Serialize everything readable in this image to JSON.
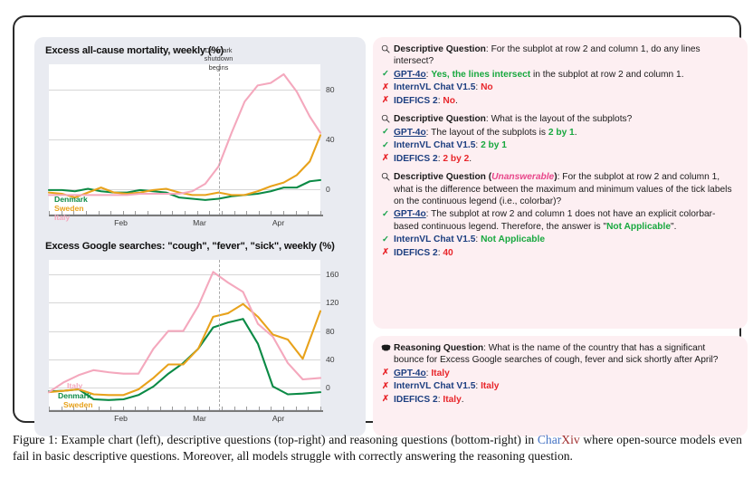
{
  "figure": {
    "caption_prefix": "Figure 1:",
    "caption_part1": " Example chart (left), descriptive questions (top-right) and reasoning questions (bottom-right) in ",
    "caption_brand_char": "Char",
    "caption_brand_xiv": "Xiv",
    "caption_part2": " where open-source models even fail in basic descriptive questions. Moreover, all models struggle with correctly answering the reasoning question."
  },
  "chart_data": [
    {
      "type": "line",
      "title": "Excess all-cause mortality, weekly (%)",
      "xlabel": "",
      "ylabel": "",
      "ylim": [
        -20,
        100
      ],
      "yticks": [
        0,
        40,
        80
      ],
      "xtick_labels": [
        "Feb",
        "Mar",
        "Apr"
      ],
      "xtick_positions": [
        0.265,
        0.555,
        0.845
      ],
      "grid": true,
      "legend_position": "inline-left",
      "annotation": {
        "text_lines": [
          "Denmark",
          "shutdown",
          "begins"
        ],
        "x_fraction": 0.625
      },
      "series": [
        {
          "name": "Denmark",
          "color": "#0b8a45",
          "x": [
            0.0,
            0.048,
            0.096,
            0.144,
            0.192,
            0.24,
            0.288,
            0.336,
            0.384,
            0.432,
            0.48,
            0.528,
            0.576,
            0.625,
            0.673,
            0.721,
            0.769,
            0.817,
            0.865,
            0.913,
            0.961,
            1.0
          ],
          "values": [
            -1,
            -1,
            -2,
            0,
            -2,
            -3,
            -3,
            -1,
            -2,
            -3,
            -7,
            -8,
            -9,
            -8,
            -6,
            -5,
            -4,
            -2,
            1,
            1,
            6,
            7
          ]
        },
        {
          "name": "Sweden",
          "color": "#e8a21b",
          "x": [
            0.0,
            0.048,
            0.096,
            0.144,
            0.192,
            0.24,
            0.288,
            0.336,
            0.384,
            0.432,
            0.48,
            0.528,
            0.576,
            0.625,
            0.673,
            0.721,
            0.769,
            0.817,
            0.865,
            0.913,
            0.961,
            1.0
          ],
          "values": [
            -3,
            -4,
            -7,
            -3,
            1,
            -3,
            -4,
            -3,
            -1,
            0,
            -3,
            -5,
            -5,
            -3,
            -5,
            -5,
            -2,
            2,
            5,
            11,
            22,
            43
          ]
        },
        {
          "name": "Italy",
          "color": "#f4a8bd",
          "x": [
            0.0,
            0.048,
            0.096,
            0.144,
            0.192,
            0.24,
            0.288,
            0.336,
            0.384,
            0.432,
            0.48,
            0.528,
            0.576,
            0.625,
            0.673,
            0.721,
            0.769,
            0.817,
            0.865,
            0.913,
            0.961,
            1.0
          ],
          "values": [
            -5,
            -5,
            -5,
            -5,
            -5,
            -5,
            -5,
            -4,
            -4,
            -4,
            -4,
            -2,
            4,
            18,
            45,
            70,
            83,
            85,
            92,
            78,
            58,
            45
          ]
        }
      ]
    },
    {
      "type": "line",
      "title": "Excess Google searches: \"cough\", \"fever\", \"sick\", weekly (%)",
      "xlabel": "",
      "ylabel": "",
      "ylim": [
        -30,
        180
      ],
      "yticks": [
        0,
        40,
        80,
        120,
        160
      ],
      "xtick_labels": [
        "Feb",
        "Mar",
        "Apr"
      ],
      "xtick_positions": [
        0.265,
        0.555,
        0.845
      ],
      "grid": true,
      "legend_position": "inline-left",
      "annotation": {
        "text_lines": [],
        "x_fraction": 0.625
      },
      "series": [
        {
          "name": "Denmark",
          "color": "#0b8a45",
          "x": [
            0.0,
            0.055,
            0.11,
            0.165,
            0.22,
            0.275,
            0.33,
            0.385,
            0.44,
            0.495,
            0.55,
            0.605,
            0.66,
            0.715,
            0.77,
            0.825,
            0.88,
            0.935,
            1.0
          ],
          "values": [
            -5,
            -4,
            -2,
            -16,
            -17,
            -16,
            -10,
            2,
            20,
            35,
            55,
            85,
            92,
            97,
            62,
            2,
            -9,
            -8,
            -6
          ]
        },
        {
          "name": "Sweden",
          "color": "#e8a21b",
          "x": [
            0.0,
            0.055,
            0.11,
            0.165,
            0.22,
            0.275,
            0.33,
            0.385,
            0.44,
            0.495,
            0.55,
            0.605,
            0.66,
            0.715,
            0.77,
            0.825,
            0.88,
            0.935,
            1.0
          ],
          "values": [
            -6,
            -4,
            -2,
            -9,
            -10,
            -10,
            -2,
            14,
            33,
            33,
            55,
            100,
            105,
            118,
            100,
            75,
            68,
            41,
            108
          ]
        },
        {
          "name": "Italy",
          "color": "#f4a8bd",
          "x": [
            0.0,
            0.055,
            0.11,
            0.165,
            0.22,
            0.275,
            0.33,
            0.385,
            0.44,
            0.495,
            0.55,
            0.605,
            0.66,
            0.715,
            0.77,
            0.825,
            0.88,
            0.935,
            1.0
          ],
          "values": [
            -6,
            8,
            18,
            25,
            22,
            20,
            20,
            55,
            80,
            80,
            115,
            163,
            148,
            135,
            90,
            72,
            35,
            12,
            14
          ]
        }
      ]
    }
  ],
  "qa": {
    "descriptive": [
      {
        "icon": "magnifier-icon",
        "label": "Descriptive Question",
        "unanswerable": null,
        "question": ": For the subplot at row 2 and column 1, do any lines intersect?",
        "answers": [
          {
            "mark": "✓",
            "correct": true,
            "model": "GPT-4o",
            "underline": true,
            "segments": [
              {
                "text": ": ",
                "style": "plain"
              },
              {
                "text": "Yes, the lines intersect",
                "style": "correct"
              },
              {
                "text": " in the subplot at row 2 and column 1.",
                "style": "plain"
              }
            ]
          },
          {
            "mark": "✗",
            "correct": false,
            "model": "InternVL Chat V1.5",
            "underline": false,
            "segments": [
              {
                "text": ": ",
                "style": "plain"
              },
              {
                "text": "No",
                "style": "wrong"
              }
            ]
          },
          {
            "mark": "✗",
            "correct": false,
            "model": "IDEFICS 2",
            "underline": false,
            "segments": [
              {
                "text": ": ",
                "style": "plain"
              },
              {
                "text": "No",
                "style": "wrong"
              },
              {
                "text": ".",
                "style": "plain"
              }
            ]
          }
        ]
      },
      {
        "icon": "magnifier-icon",
        "label": "Descriptive Question",
        "unanswerable": null,
        "question": ": What is the layout of the subplots?",
        "answers": [
          {
            "mark": "✓",
            "correct": true,
            "model": "GPT-4o",
            "underline": true,
            "segments": [
              {
                "text": ": The layout of the subplots is ",
                "style": "plain"
              },
              {
                "text": "2 by 1",
                "style": "correct"
              },
              {
                "text": ".",
                "style": "plain"
              }
            ]
          },
          {
            "mark": "✓",
            "correct": true,
            "model": "InternVL Chat V1.5",
            "underline": false,
            "segments": [
              {
                "text": ": ",
                "style": "plain"
              },
              {
                "text": "2 by 1",
                "style": "correct"
              }
            ]
          },
          {
            "mark": "✗",
            "correct": false,
            "model": "IDEFICS 2",
            "underline": false,
            "segments": [
              {
                "text": ": ",
                "style": "plain"
              },
              {
                "text": "2 by 2",
                "style": "wrong"
              },
              {
                "text": ".",
                "style": "plain"
              }
            ]
          }
        ]
      },
      {
        "icon": "magnifier-icon",
        "label": "Descriptive Question",
        "unanswerable": "Unanswerable",
        "question": ": For the subplot at row 2 and column 1, what is the difference between the maximum and minimum values of the tick labels on the continuous legend (i.e., colorbar)?",
        "answers": [
          {
            "mark": "✓",
            "correct": true,
            "model": "GPT-4o",
            "underline": true,
            "segments": [
              {
                "text": ": The subplot at row 2 and column 1 does not have an explicit colorbar-based continuous legend. Therefore, the answer is \"",
                "style": "plain"
              },
              {
                "text": "Not Applicable",
                "style": "correct"
              },
              {
                "text": "\".",
                "style": "plain"
              }
            ]
          },
          {
            "mark": "✓",
            "correct": true,
            "model": "InternVL Chat V1.5",
            "underline": false,
            "segments": [
              {
                "text": ": ",
                "style": "plain"
              },
              {
                "text": "Not Applicable",
                "style": "correct"
              }
            ]
          },
          {
            "mark": "✗",
            "correct": false,
            "model": "IDEFICS 2",
            "underline": false,
            "segments": [
              {
                "text": ": ",
                "style": "plain"
              },
              {
                "text": "40",
                "style": "wrong"
              }
            ]
          }
        ]
      }
    ],
    "reasoning": [
      {
        "icon": "brain-icon",
        "label": "Reasoning Question",
        "unanswerable": null,
        "question": ": What is the name of the country that has a significant bounce for Excess Google searches of cough, fever and sick shortly after April?",
        "answers": [
          {
            "mark": "✗",
            "correct": false,
            "model": "GPT-4o",
            "underline": true,
            "segments": [
              {
                "text": ": ",
                "style": "plain"
              },
              {
                "text": "Italy",
                "style": "wrong"
              }
            ]
          },
          {
            "mark": "✗",
            "correct": false,
            "model": "InternVL Chat V1.5",
            "underline": false,
            "segments": [
              {
                "text": ": ",
                "style": "plain"
              },
              {
                "text": "Italy",
                "style": "wrong"
              }
            ]
          },
          {
            "mark": "✗",
            "correct": false,
            "model": "IDEFICS 2",
            "underline": false,
            "segments": [
              {
                "text": ": ",
                "style": "plain"
              },
              {
                "text": "Italy",
                "style": "wrong"
              },
              {
                "text": ".",
                "style": "plain"
              }
            ]
          }
        ]
      }
    ]
  },
  "colors": {
    "denmark": "#0b8a45",
    "sweden": "#e8a21b",
    "italy": "#f4a8bd",
    "panel_bg": "#e9ebf1",
    "qa_bg": "#fdeff2",
    "correct": "#18a83f",
    "wrong": "#e8262b",
    "model": "#1d3f80",
    "unanswerable": "#e8468a"
  }
}
